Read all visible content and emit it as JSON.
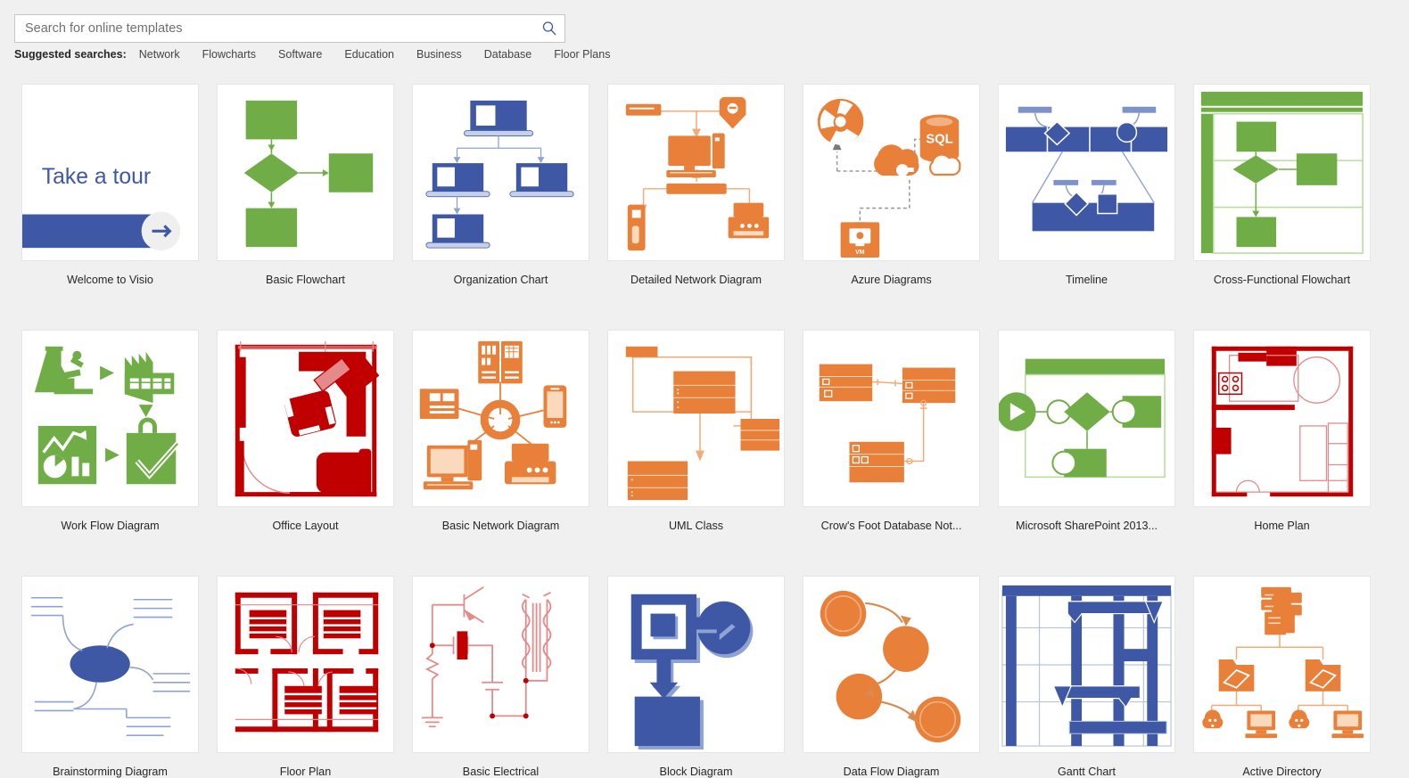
{
  "search": {
    "placeholder": "Search for online templates",
    "value": "",
    "icon": "search-icon"
  },
  "suggested": {
    "label": "Suggested searches:",
    "items": [
      "Network",
      "Flowcharts",
      "Software",
      "Education",
      "Business",
      "Database",
      "Floor Plans"
    ]
  },
  "colors": {
    "background": "#f0f0f0",
    "card": "#ffffff",
    "card_border": "#e6e6e6",
    "green": "#70ad47",
    "green_light": "#a9d18e",
    "blue": "#3e58a6",
    "blue_light": "#8ea2d4",
    "orange": "#e8803a",
    "orange_light": "#f0ab78",
    "red": "#c00000",
    "red_light": "#e48a8a",
    "text": "#262626"
  },
  "templates": [
    {
      "id": "welcome-to-visio",
      "label": "Welcome to Visio",
      "art": "take-a-tour",
      "tour_text": "Take a tour"
    },
    {
      "id": "basic-flowchart",
      "label": "Basic Flowchart",
      "art": "basic-flowchart"
    },
    {
      "id": "organization-chart",
      "label": "Organization Chart",
      "art": "organization-chart"
    },
    {
      "id": "detailed-network-diagram",
      "label": "Detailed Network Diagram",
      "art": "detailed-network"
    },
    {
      "id": "azure-diagrams",
      "label": "Azure Diagrams",
      "art": "azure",
      "sql_text": "SQL",
      "vm_text": "VM"
    },
    {
      "id": "timeline",
      "label": "Timeline",
      "art": "timeline"
    },
    {
      "id": "cross-functional-flowchart",
      "label": "Cross-Functional Flowchart",
      "art": "cross-functional"
    },
    {
      "id": "work-flow-diagram",
      "label": "Work Flow Diagram",
      "art": "work-flow"
    },
    {
      "id": "office-layout",
      "label": "Office Layout",
      "art": "office-layout"
    },
    {
      "id": "basic-network-diagram",
      "label": "Basic Network Diagram",
      "art": "basic-network"
    },
    {
      "id": "uml-class",
      "label": "UML Class",
      "art": "uml-class"
    },
    {
      "id": "crows-foot-database",
      "label": "Crow's Foot Database Not...",
      "art": "crows-foot"
    },
    {
      "id": "microsoft-sharepoint-2013",
      "label": "Microsoft SharePoint 2013...",
      "art": "sharepoint"
    },
    {
      "id": "home-plan",
      "label": "Home Plan",
      "art": "home-plan"
    },
    {
      "id": "brainstorming-diagram",
      "label": "Brainstorming Diagram",
      "art": "brainstorming"
    },
    {
      "id": "floor-plan",
      "label": "Floor Plan",
      "art": "floor-plan"
    },
    {
      "id": "basic-electrical",
      "label": "Basic Electrical",
      "art": "basic-electrical"
    },
    {
      "id": "block-diagram",
      "label": "Block Diagram",
      "art": "block-diagram"
    },
    {
      "id": "data-flow-diagram",
      "label": "Data Flow Diagram",
      "art": "data-flow"
    },
    {
      "id": "gantt-chart",
      "label": "Gantt Chart",
      "art": "gantt"
    },
    {
      "id": "active-directory",
      "label": "Active Directory",
      "art": "active-directory"
    }
  ]
}
